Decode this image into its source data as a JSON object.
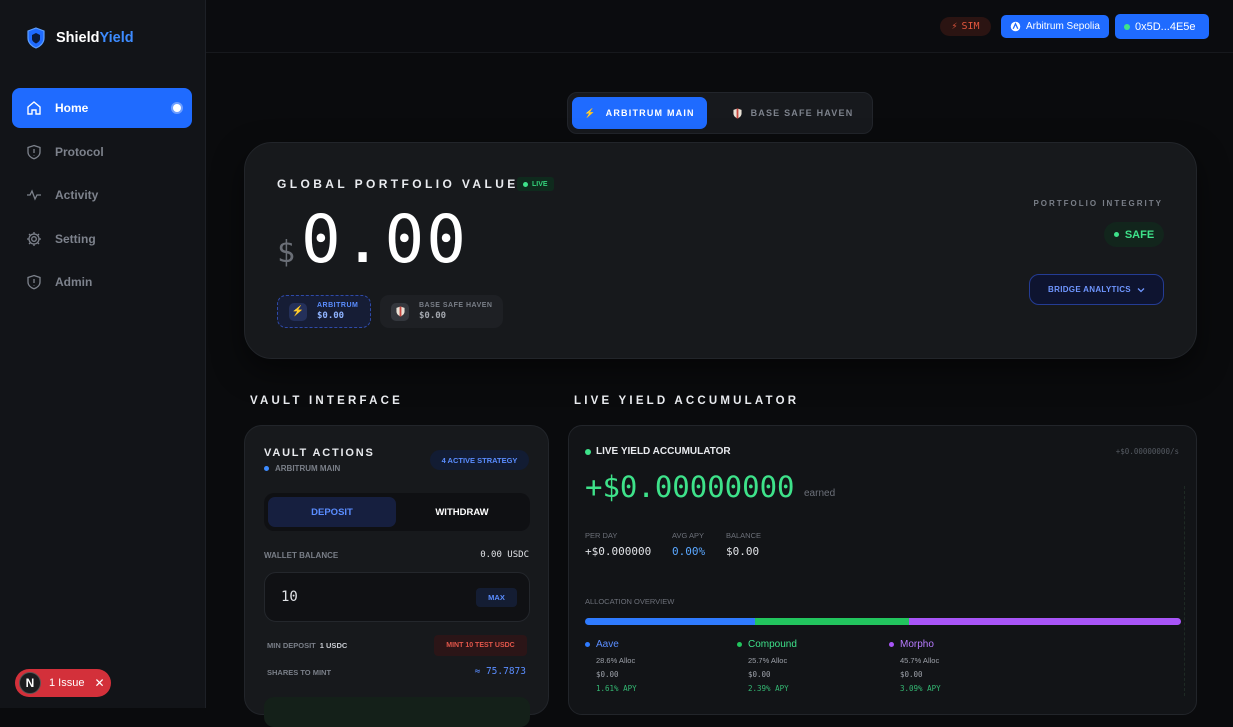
{
  "brand": {
    "name_a": "Shield",
    "name_b": "Yield"
  },
  "nav": [
    {
      "label": "Home",
      "icon": "home-icon",
      "active": true
    },
    {
      "label": "Protocol",
      "icon": "shield-icon"
    },
    {
      "label": "Activity",
      "icon": "pulse-icon"
    },
    {
      "label": "Setting",
      "icon": "gear-icon"
    },
    {
      "label": "Admin",
      "icon": "shield-icon"
    }
  ],
  "issue": {
    "badge": "N",
    "label": "1 Issue"
  },
  "topbar": {
    "sim": "SIM",
    "network": "Arbitrum Sepolia",
    "address": "0x5D...4E5e"
  },
  "chain_tabs": {
    "tab1": "ARBITRUM MAIN",
    "tab2": "BASE SAFE HAVEN"
  },
  "portfolio": {
    "title": "GLOBAL PORTFOLIO VALUE",
    "live": "LIVE",
    "currency": "$",
    "value": "0.00",
    "chip1": {
      "label": "ARBITRUM",
      "value": "$0.00"
    },
    "chip2": {
      "label": "BASE SAFE HAVEN",
      "value": "$0.00"
    },
    "integrity_title": "PORTFOLIO INTEGRITY",
    "integrity_status": "SAFE",
    "bridge_btn": "BRIDGE ANALYTICS"
  },
  "sections": {
    "vault": "VAULT INTERFACE",
    "yield": "LIVE YIELD ACCUMULATOR"
  },
  "vault": {
    "title": "VAULT ACTIONS",
    "subtitle": "ARBITRUM MAIN",
    "strategy": "4 ACTIVE STRATEGY",
    "deposit": "DEPOSIT",
    "withdraw": "WITHDRAW",
    "wallet_label": "WALLET BALANCE",
    "wallet_value": "0.00 USDC",
    "amount": "10",
    "max": "MAX",
    "min_label": "MIN DEPOSIT",
    "min_value": "1 USDC",
    "mint": "MINT 10 TEST USDC",
    "shares_label": "SHARES TO MINT",
    "shares_value": "≈ 75.7873"
  },
  "yield": {
    "title": "LIVE YIELD ACCUMULATOR",
    "rate": "+$0.00000000/s",
    "value": "+$0.00000000",
    "earned": "earned",
    "per_day_label": "PER DAY",
    "per_day_value": "+$0.000000",
    "apy_label": "AVG APY",
    "apy_value": "0.00%",
    "balance_label": "BALANCE",
    "balance_value": "$0.00",
    "alloc_label": "ALLOCATION OVERVIEW",
    "protocols": [
      {
        "name": "Aave",
        "alloc": "28.6% Alloc",
        "value": "$0.00",
        "apy": "1.61% APY",
        "color": "#2f7bff",
        "pct": 28.6
      },
      {
        "name": "Compound",
        "alloc": "25.7% Alloc",
        "value": "$0.00",
        "apy": "2.39% APY",
        "color": "#22c55e",
        "pct": 25.7
      },
      {
        "name": "Morpho",
        "alloc": "45.7% Alloc",
        "value": "$0.00",
        "apy": "3.09% APY",
        "color": "#a855f7",
        "pct": 45.7
      }
    ]
  }
}
